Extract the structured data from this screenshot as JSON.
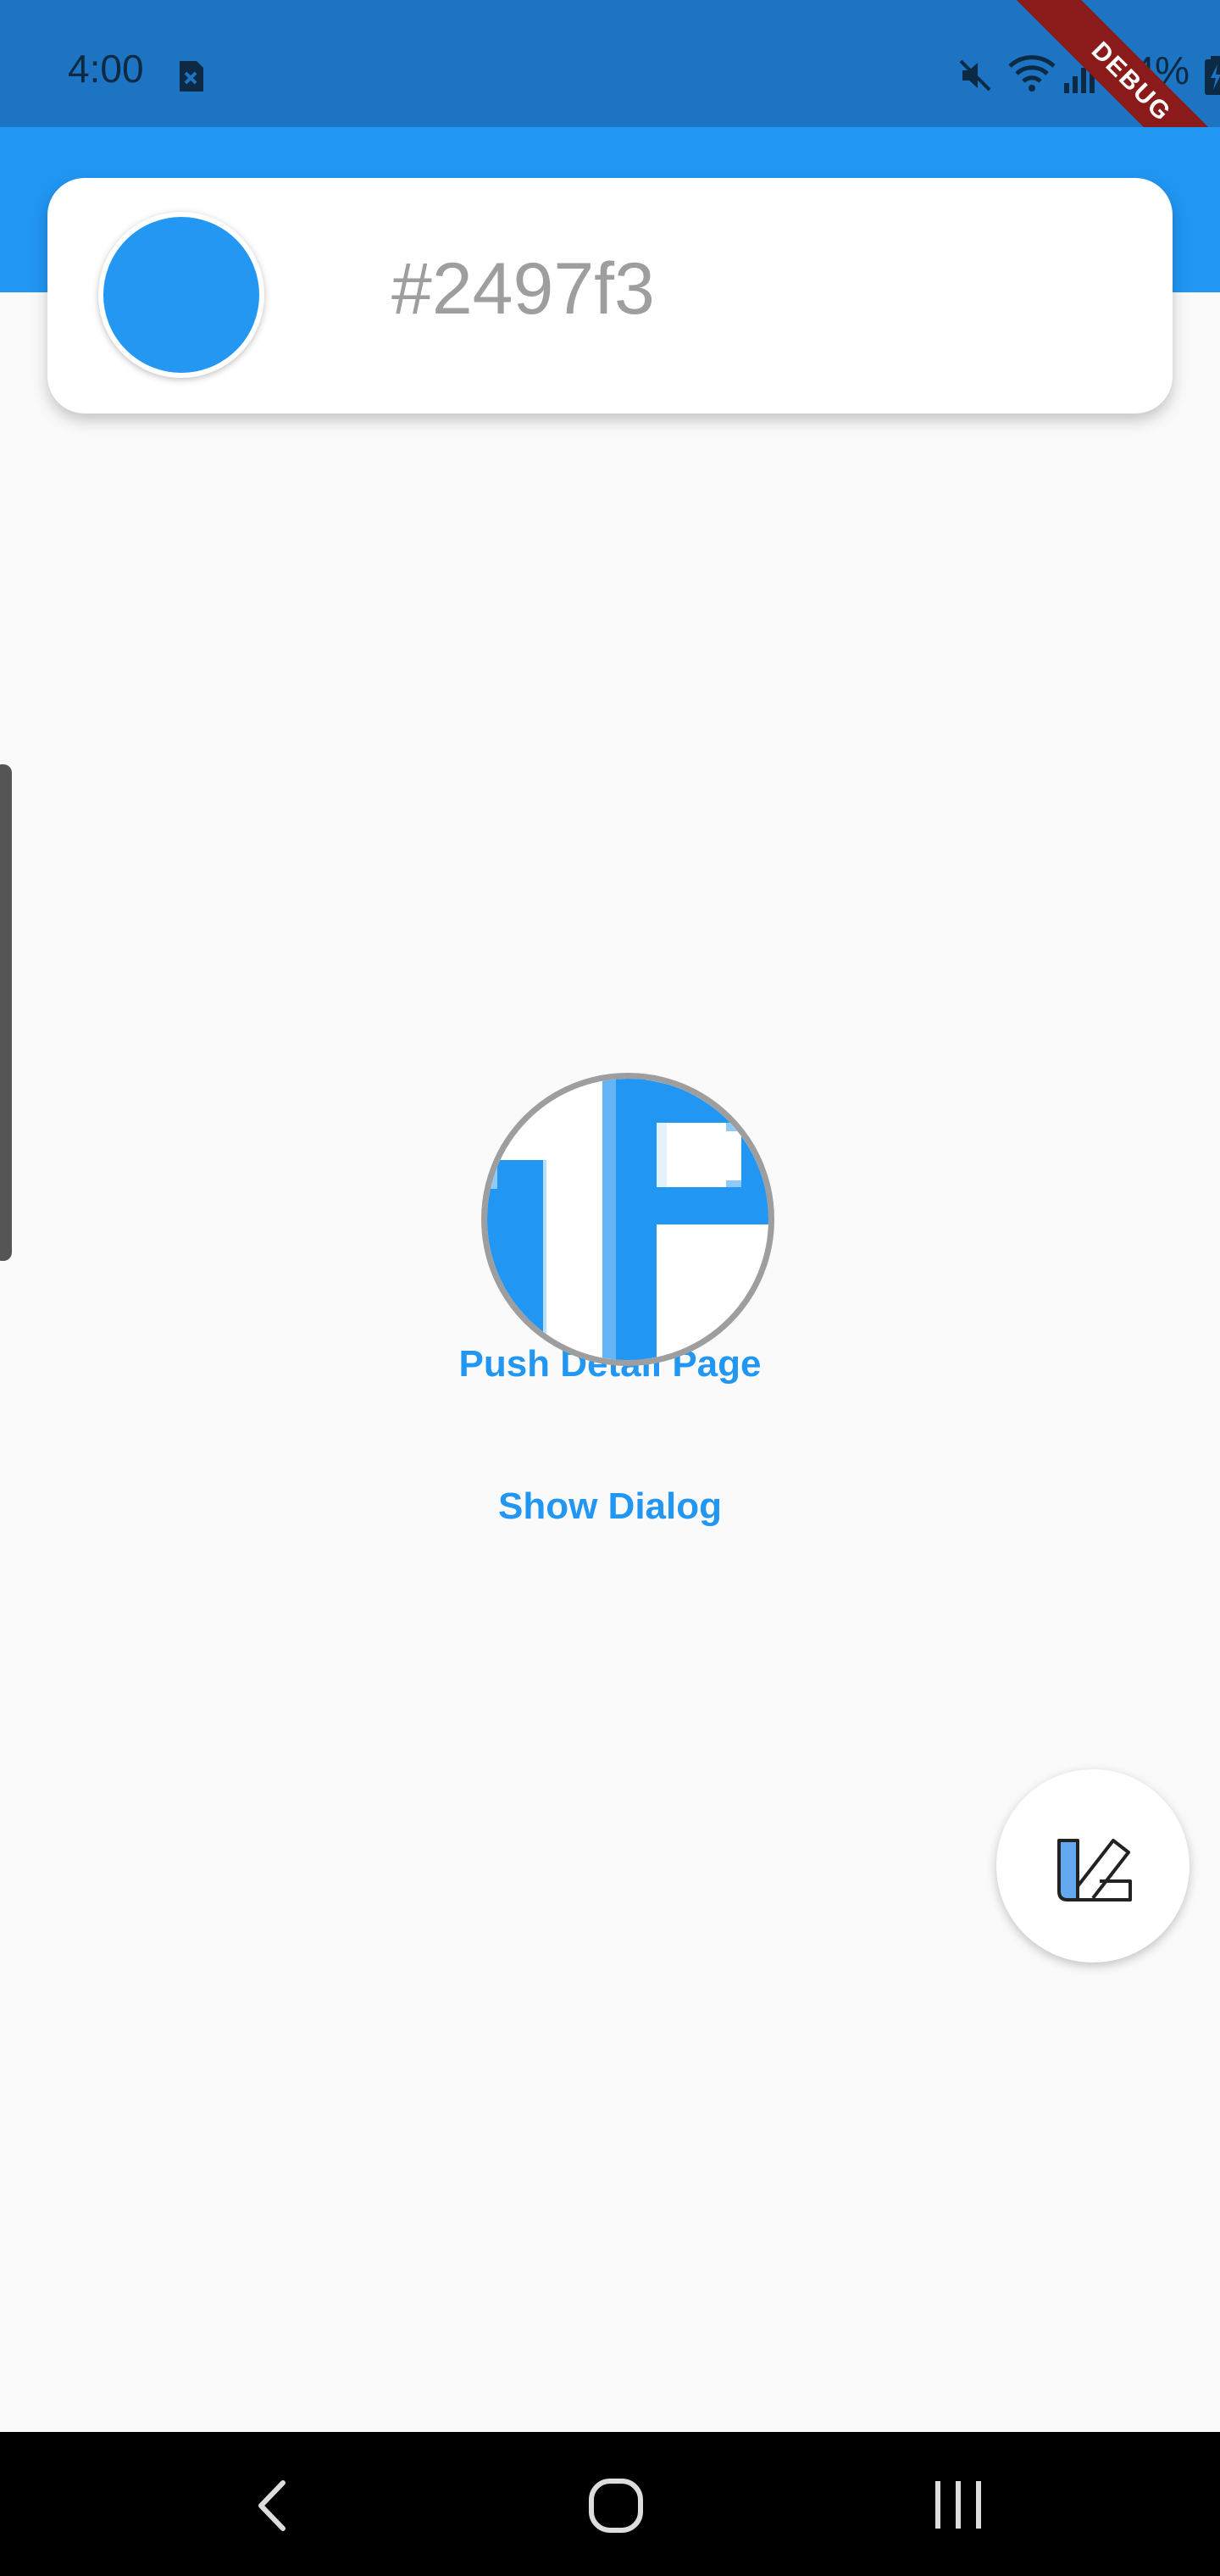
{
  "status_bar": {
    "time": "4:00",
    "battery": "84%",
    "icons": [
      "sim-card-icon",
      "mute-icon",
      "wifi-icon",
      "signal-icon",
      "battery-charging-icon"
    ]
  },
  "debug_banner": "DEBUG",
  "color_card": {
    "hex": "#2497f3",
    "swatch_color": "#2497f3"
  },
  "buttons": {
    "push_detail": "Push Detail Page",
    "show_dialog": "Show Dialog"
  },
  "fab": {
    "icon": "color-picker-icon"
  },
  "nav_bar": {
    "icons": [
      "back-icon",
      "home-icon",
      "recent-apps-icon"
    ]
  },
  "colors": {
    "accent": "#2196f3",
    "status_bar": "#1c74c2",
    "debug": "#8b1a1a"
  }
}
